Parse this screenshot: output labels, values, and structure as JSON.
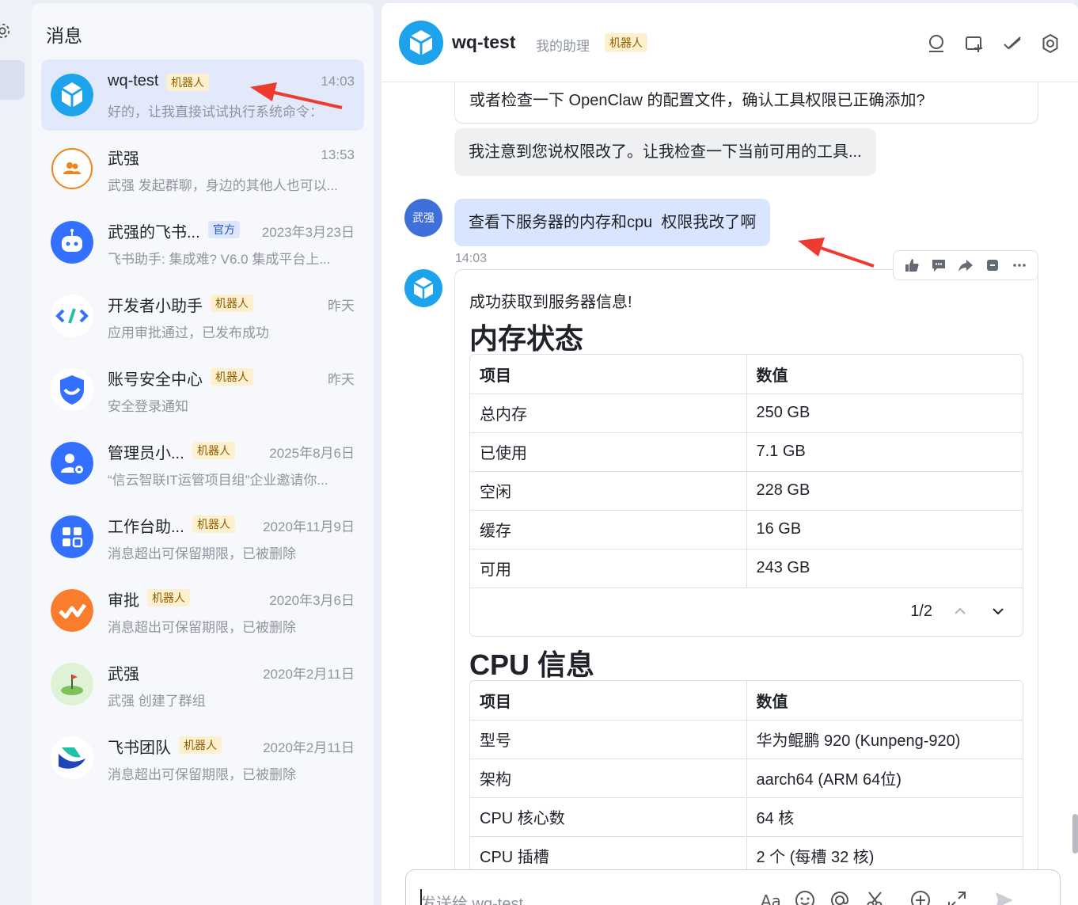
{
  "sidebar_title": "消息",
  "conversations": [
    {
      "name": "wq-test",
      "tag": "机器人",
      "tag_type": "bot",
      "time": "14:03",
      "preview": "好的，让我直接试试执行系统命令：",
      "avatar": "cube-bot-icon",
      "active": true
    },
    {
      "name": "武强",
      "tag": "",
      "tag_type": "",
      "time": "13:53",
      "preview": "武强 发起群聊，身边的其他人也可以...",
      "avatar": "group-icon"
    },
    {
      "name": "武强的飞书...",
      "tag": "官方",
      "tag_type": "official",
      "time": "2023年3月23日",
      "preview": "飞书助手: 集成难? V6.0 集成平台上...",
      "avatar": "robot-icon"
    },
    {
      "name": "开发者小助手",
      "tag": "机器人",
      "tag_type": "bot",
      "time": "昨天",
      "preview": "应用审批通过，已发布成功",
      "avatar": "code-icon"
    },
    {
      "name": "账号安全中心",
      "tag": "机器人",
      "tag_type": "bot",
      "time": "昨天",
      "preview": "安全登录通知",
      "avatar": "shield-icon"
    },
    {
      "name": "管理员小...",
      "tag": "机器人",
      "tag_type": "bot",
      "time": "2025年8月6日",
      "preview": "“信云智联IT运管项目组”企业邀请你...",
      "avatar": "admin-icon"
    },
    {
      "name": "工作台助...",
      "tag": "机器人",
      "tag_type": "bot",
      "time": "2020年11月9日",
      "preview": "消息超出可保留期限，已被删除",
      "avatar": "apps-grid-icon"
    },
    {
      "name": "审批",
      "tag": "机器人",
      "tag_type": "bot",
      "time": "2020年3月6日",
      "preview": "消息超出可保留期限，已被删除",
      "avatar": "approval-icon"
    },
    {
      "name": "武强",
      "tag": "",
      "tag_type": "",
      "time": "2020年2月11日",
      "preview": "武强 创建了群组",
      "avatar": "golf-flag-icon"
    },
    {
      "name": "飞书团队",
      "tag": "机器人",
      "tag_type": "bot",
      "time": "2020年2月11日",
      "preview": "消息超出可保留期限，已被删除",
      "avatar": "feishu-bird-icon"
    }
  ],
  "chat": {
    "name": "wq-test",
    "subtitle": "我的助理",
    "tag": "机器人",
    "header_icons": [
      "search-chat-icon",
      "new-window-icon",
      "done-icon",
      "settings-icon"
    ]
  },
  "messages": {
    "bot_partial": "或者检查一下 OpenClaw 的配置文件，确认工具权限已正确添加?",
    "bot_gray": "我注意到您说权限改了。让我检查一下当前可用的工具...",
    "user_avatar_text": "武强",
    "user_message": "查看下服务器的内存和cpu  权限我改了啊",
    "time": "14:03",
    "action_icons": [
      "thumbs-up-icon",
      "reply-icon",
      "forward-icon",
      "pin-icon",
      "more-icon"
    ]
  },
  "card": {
    "lead": "成功获取到服务器信息!",
    "memory_heading": "内存状态",
    "memory_table": {
      "headers": [
        "项目",
        "数值"
      ],
      "rows": [
        [
          "总内存",
          "250 GB"
        ],
        [
          "已使用",
          "7.1 GB"
        ],
        [
          "空闲",
          "228 GB"
        ],
        [
          "缓存",
          "16 GB"
        ],
        [
          "可用",
          "243 GB"
        ]
      ],
      "pager": "1/2"
    },
    "cpu_heading": "CPU 信息",
    "cpu_table": {
      "headers": [
        "项目",
        "数值"
      ],
      "rows": [
        [
          "型号",
          "华为鲲鹏 920 (Kunpeng-920)"
        ],
        [
          "架构",
          "aarch64 (ARM 64位)"
        ],
        [
          "CPU 核心数",
          "64 核"
        ],
        [
          "CPU 插槽",
          "2 个 (每槽 32 核)"
        ]
      ]
    }
  },
  "composer": {
    "placeholder": "发送给 wq-test",
    "tool_icons": [
      "font-icon",
      "emoji-icon",
      "mention-icon",
      "screenshot-icon",
      "add-icon",
      "expand-icon",
      "send-icon"
    ]
  },
  "colors": {
    "accent": "#3370ff",
    "bot_tag_bg": "#fdf0cf",
    "bot_tag_fg": "#8f5d00",
    "arrow": "#ee3b2f"
  }
}
